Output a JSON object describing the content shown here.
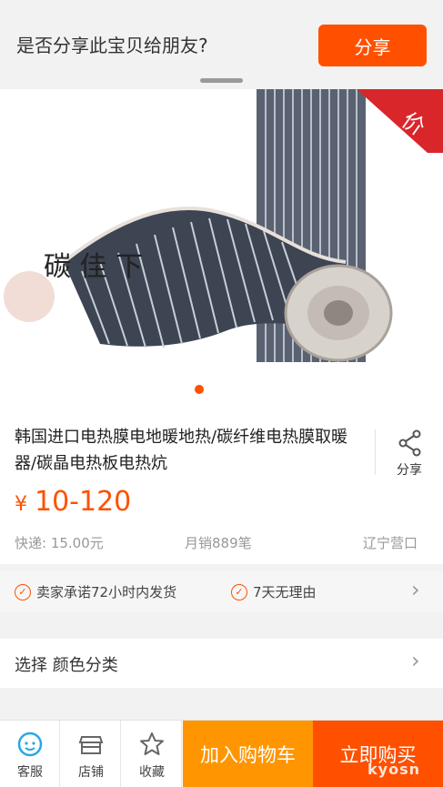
{
  "share_banner": {
    "question": "是否分享此宝贝给朋友?",
    "button": "分享"
  },
  "product": {
    "badge": "价",
    "image_text": "碳 佳 下"
  },
  "info": {
    "title": "韩国进口电热膜电地暖地热/碳纤维电热膜取暖器/碳晶电热板电热炕",
    "share_label": "分享",
    "price_symbol": "¥",
    "price": "10-120",
    "shipping": "快递: 15.00元",
    "sales": "月销889笔",
    "location": "辽宁营口"
  },
  "promises": {
    "item1": "卖家承诺72小时内发货",
    "item2": "7天无理由"
  },
  "select": {
    "label": "选择  颜色分类"
  },
  "bottom_bar": {
    "service": "客服",
    "shop": "店铺",
    "favorite": "收藏",
    "add_to_cart": "加入购物车",
    "buy_now": "立即购买"
  },
  "watermark": "kyosn",
  "colors": {
    "accent": "#ff5000",
    "cart": "#ff9500"
  }
}
